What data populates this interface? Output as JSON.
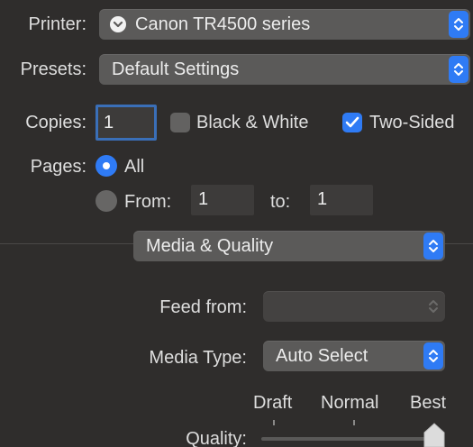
{
  "printer": {
    "label": "Printer:",
    "value": "Canon TR4500 series"
  },
  "presets": {
    "label": "Presets:",
    "value": "Default Settings"
  },
  "copies": {
    "label": "Copies:",
    "value": "1"
  },
  "black_white": {
    "label": "Black & White",
    "checked": false
  },
  "two_sided": {
    "label": "Two-Sided",
    "checked": true
  },
  "pages": {
    "label": "Pages:",
    "all_label": "All",
    "all_selected": true,
    "from_label": "From:",
    "from_value": "1",
    "to_label": "to:",
    "to_value": "1"
  },
  "section": {
    "value": "Media & Quality"
  },
  "feed_from": {
    "label": "Feed from:",
    "value": ""
  },
  "media_type": {
    "label": "Media Type:",
    "value": "Auto Select"
  },
  "quality": {
    "label": "Quality:",
    "levels": [
      "Draft",
      "Normal",
      "Best"
    ],
    "selected": "Best"
  },
  "colors": {
    "accent": "#2f7bf5",
    "background": "#2f2d2c",
    "control": "#5b5a59"
  }
}
